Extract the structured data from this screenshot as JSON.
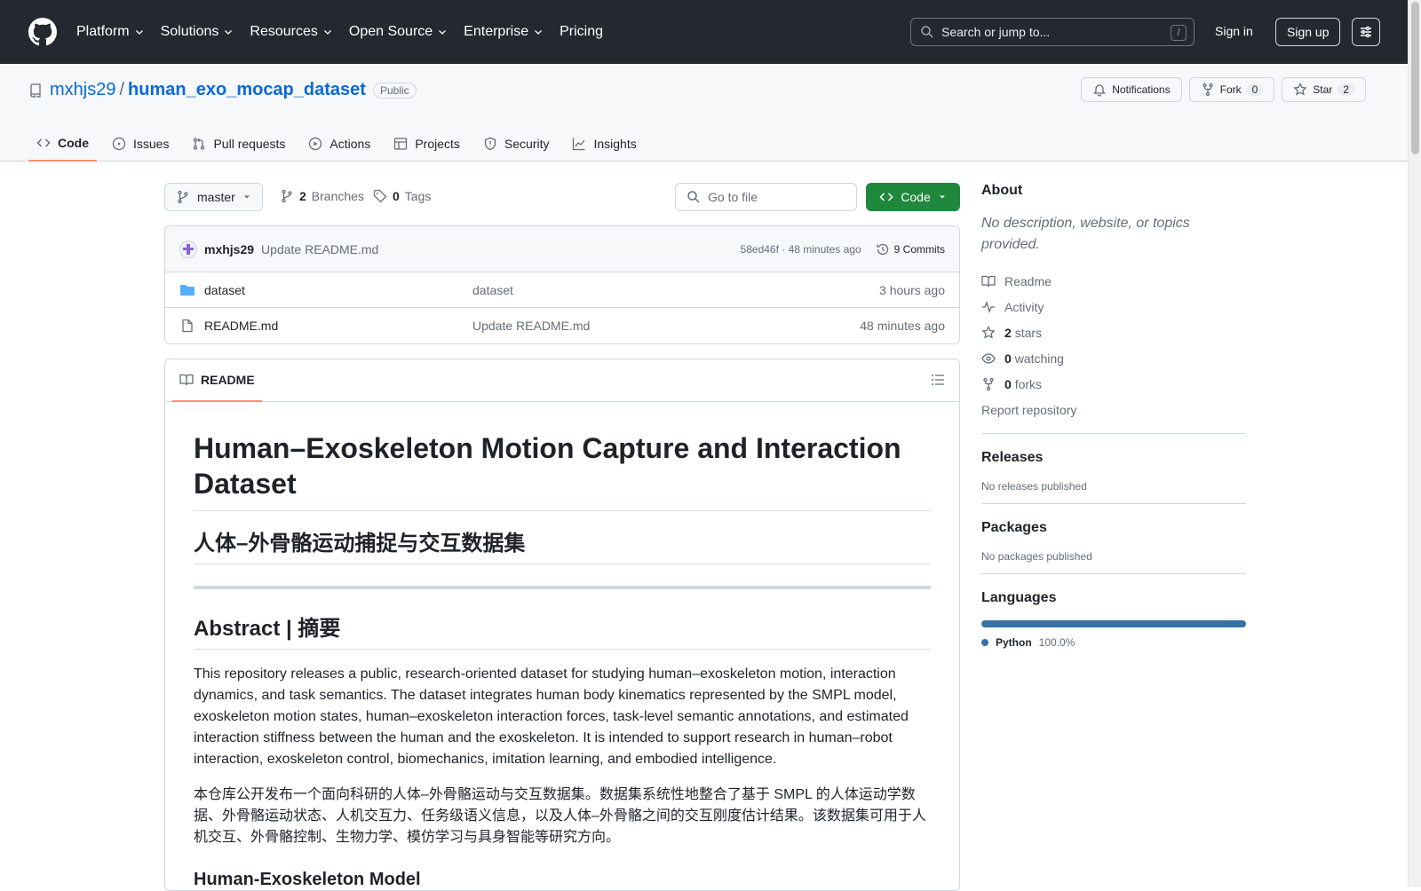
{
  "header": {
    "nav": [
      "Platform",
      "Solutions",
      "Resources",
      "Open Source",
      "Enterprise",
      "Pricing"
    ],
    "search_placeholder": "Search or jump to...",
    "slash_key": "/",
    "sign_in": "Sign in",
    "sign_up": "Sign up"
  },
  "repo": {
    "owner": "mxhjs29",
    "separator": "/",
    "name": "human_exo_mocap_dataset",
    "visibility": "Public",
    "notifications_label": "Notifications",
    "fork_label": "Fork",
    "fork_count": "0",
    "star_label": "Star",
    "star_count": "2",
    "tabs": [
      "Code",
      "Issues",
      "Pull requests",
      "Actions",
      "Projects",
      "Security",
      "Insights"
    ]
  },
  "toolbar": {
    "branch": "master",
    "branches_count": "2",
    "branches_label": "Branches",
    "tags_count": "0",
    "tags_label": "Tags",
    "go_to_file": "Go to file",
    "code_button": "Code"
  },
  "commit": {
    "author": "mxhjs29",
    "message": "Update README.md",
    "hash_time": "58ed46f · 48 minutes ago",
    "commits": "9 Commits"
  },
  "files": [
    {
      "name": "dataset",
      "type": "folder",
      "message": "dataset",
      "date": "3 hours ago"
    },
    {
      "name": "README.md",
      "type": "file",
      "message": "Update README.md",
      "date": "48 minutes ago"
    }
  ],
  "readme": {
    "tab_label": "README",
    "h1": "Human–Exoskeleton Motion Capture and Interaction Dataset",
    "h2_cn": "人体–外骨骼运动捕捉与交互数据集",
    "h2_abstract": "Abstract | 摘要",
    "p_en": "This repository releases a public, research-oriented dataset for studying human–exoskeleton motion, interaction dynamics, and task semantics. The dataset integrates human body kinematics represented by the SMPL model, exoskeleton motion states, human–exoskeleton interaction forces, task-level semantic annotations, and estimated interaction stiffness between the human and the exoskeleton. It is intended to support research in human–robot interaction, exoskeleton control, biomechanics, imitation learning, and embodied intelligence.",
    "p_cn": "本仓库公开发布一个面向科研的人体–外骨骼运动与交互数据集。数据集系统性地整合了基于 SMPL 的人体运动学数据、外骨骼运动状态、人机交互力、任务级语义信息，以及人体–外骨骼之间的交互刚度估计结果。该数据集可用于人机交互、外骨骼控制、生物力学、模仿学习与具身智能等研究方向。",
    "h3": "Human-Exoskeleton Model"
  },
  "sidebar": {
    "about_title": "About",
    "about_desc": "No description, website, or topics provided.",
    "readme_link": "Readme",
    "activity_link": "Activity",
    "stars_count": "2",
    "stars_label": "stars",
    "watching_count": "0",
    "watching_label": "watching",
    "forks_count": "0",
    "forks_label": "forks",
    "report": "Report repository",
    "releases_title": "Releases",
    "releases_desc": "No releases published",
    "packages_title": "Packages",
    "packages_desc": "No packages published",
    "languages_title": "Languages",
    "language_name": "Python",
    "language_pct": "100.0%",
    "language_color": "#3572a5"
  }
}
